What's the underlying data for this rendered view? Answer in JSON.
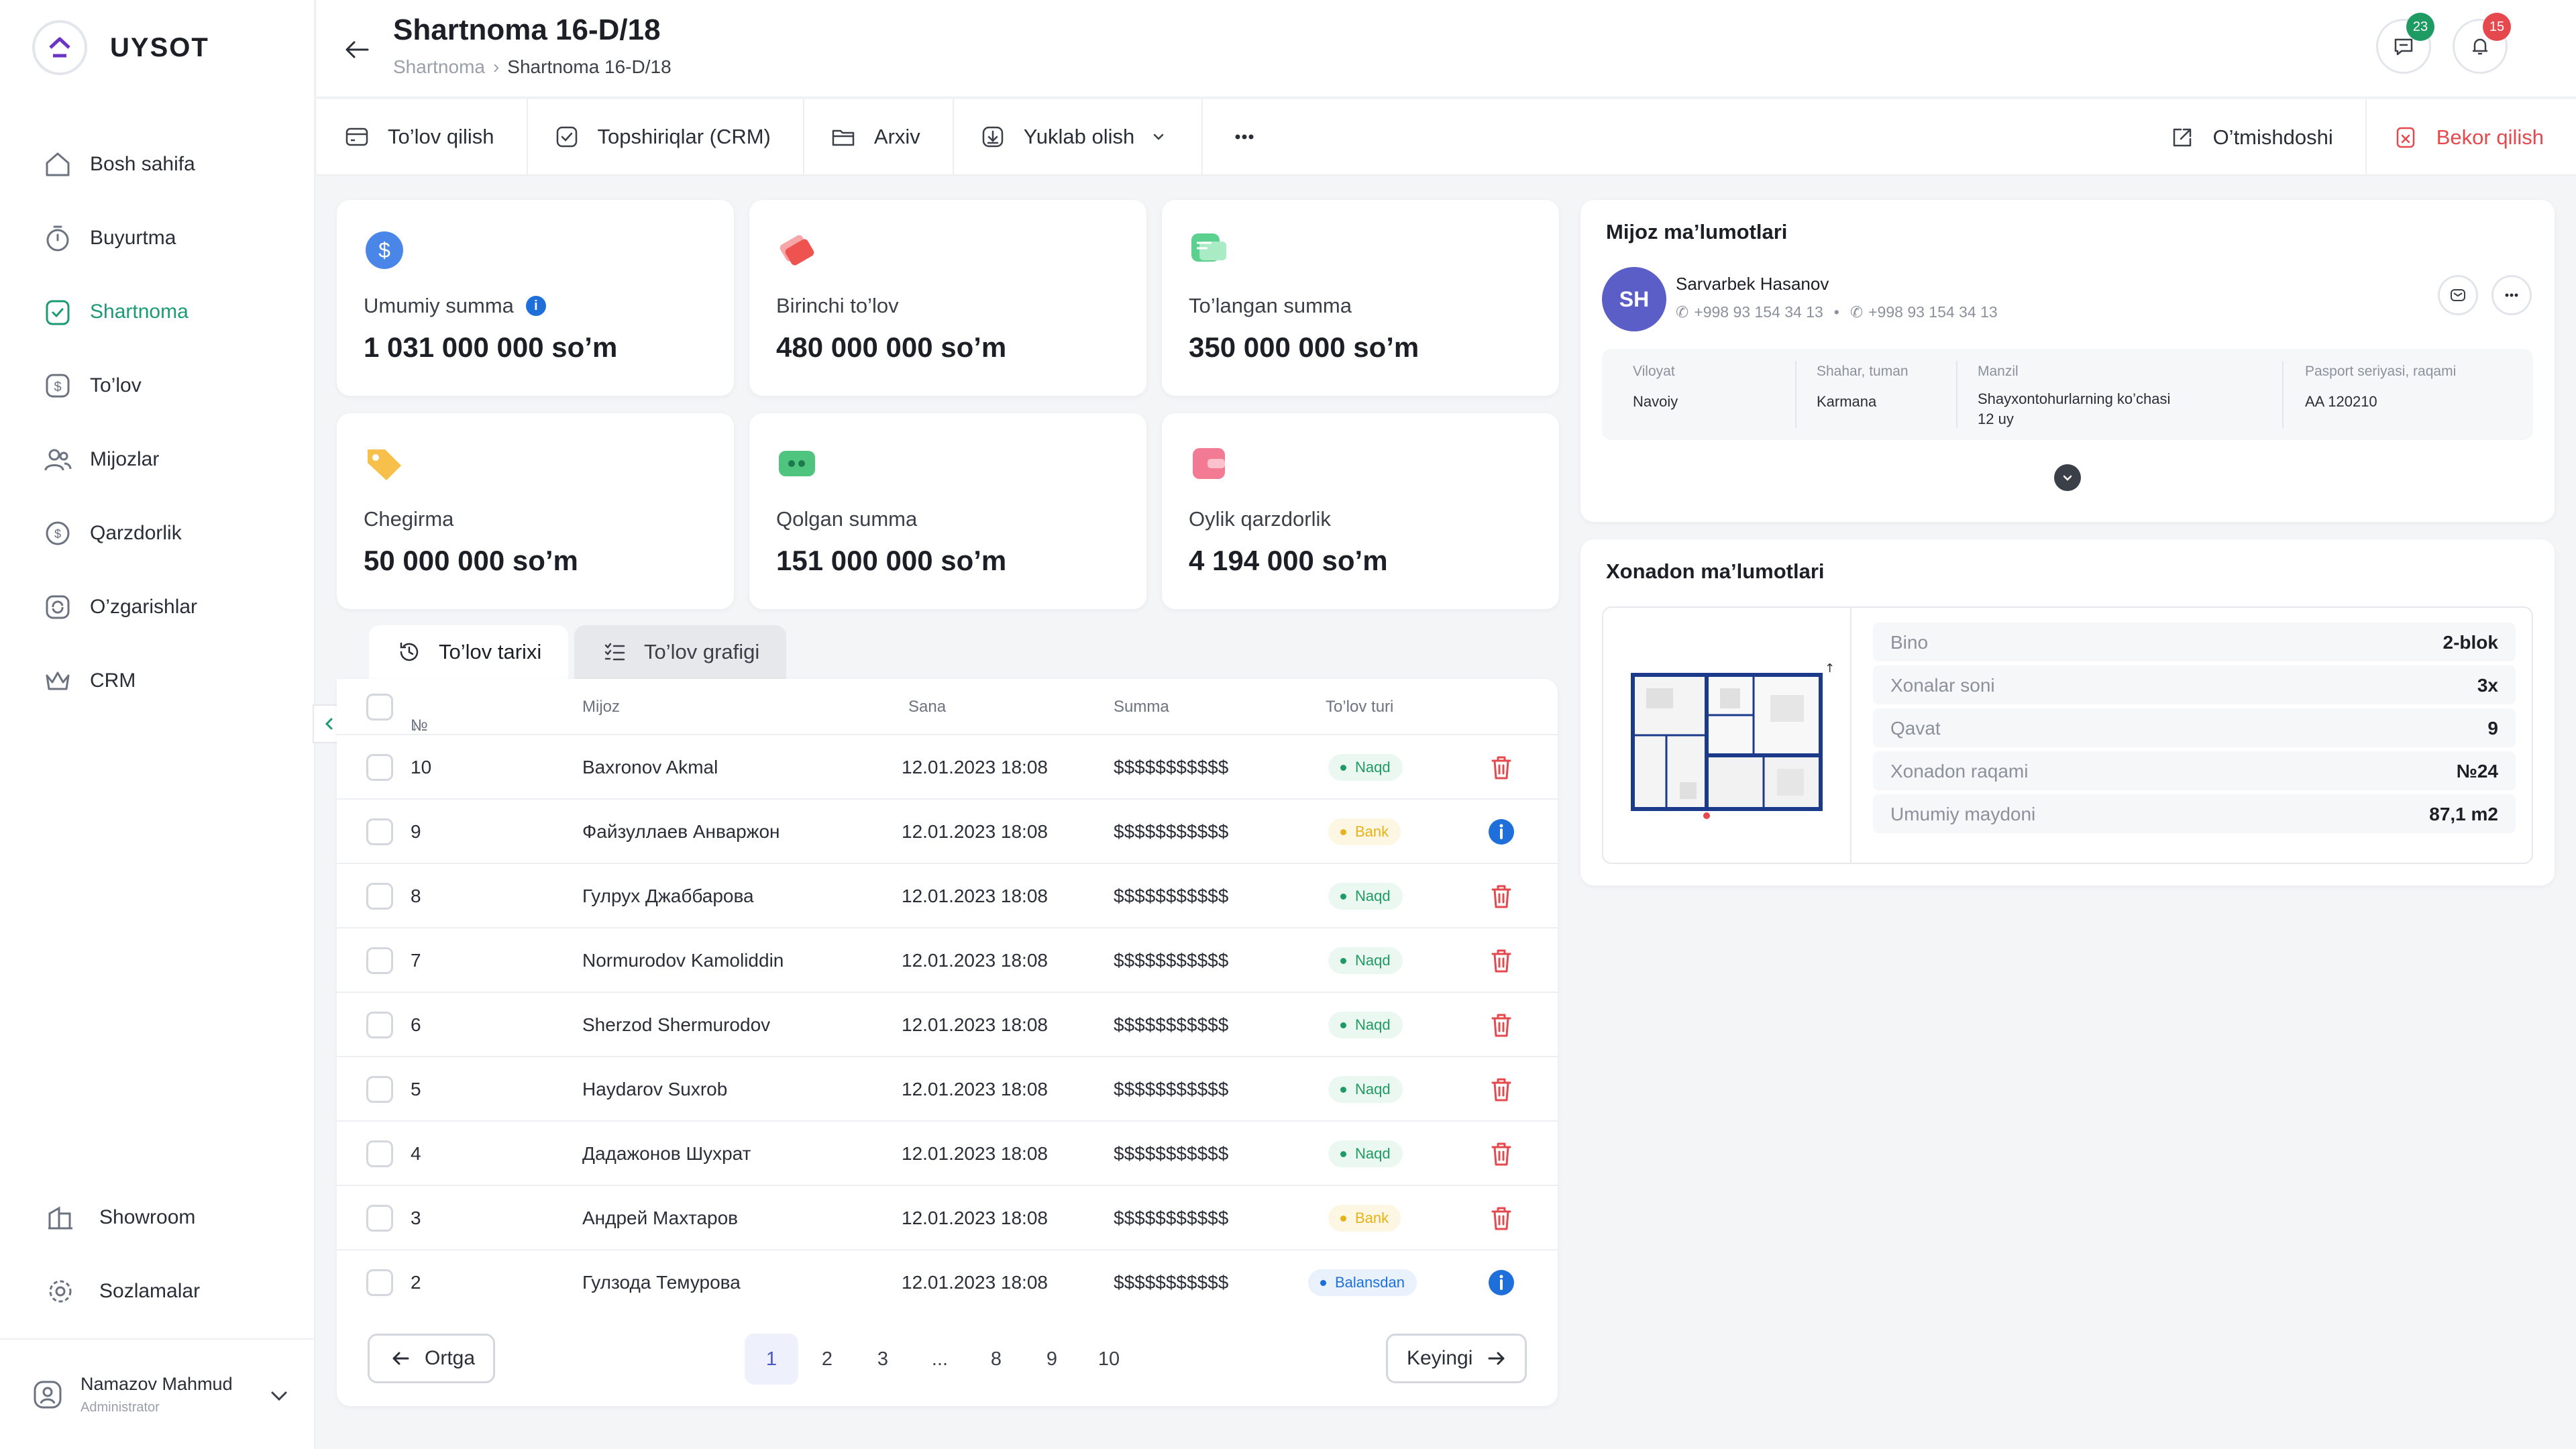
{
  "brand": {
    "name": "UYSOT"
  },
  "sidebar": {
    "items": [
      {
        "label": "Bosh sahifa",
        "icon": "home-icon"
      },
      {
        "label": "Buyurtma",
        "icon": "timer-icon"
      },
      {
        "label": "Shartnoma",
        "icon": "shield-check-icon",
        "active": true
      },
      {
        "label": "To’lov",
        "icon": "dollar-icon"
      },
      {
        "label": "Mijozlar",
        "icon": "users-icon"
      },
      {
        "label": "Qarzdorlik",
        "icon": "debt-icon"
      },
      {
        "label": "O’zgarishlar",
        "icon": "refresh-icon"
      },
      {
        "label": "CRM",
        "icon": "crown-icon"
      }
    ],
    "bottom": [
      {
        "label": "Showroom",
        "icon": "building-icon"
      },
      {
        "label": "Sozlamalar",
        "icon": "gear-icon"
      }
    ],
    "user": {
      "name": "Namazov Mahmud",
      "role": "Administrator"
    }
  },
  "header": {
    "title": "Shartnoma 16-D/18",
    "breadcrumb": [
      "Shartnoma",
      "Shartnoma 16-D/18"
    ],
    "messages_count": "23",
    "notifications_count": "15"
  },
  "toolbar": {
    "pay": "To’lov qilish",
    "tasks": "Topshiriqlar (CRM)",
    "archive": "Arxiv",
    "download": "Yuklab olish",
    "predecessor": "O’tmishdoshi",
    "cancel": "Bekor qilish"
  },
  "stats": [
    {
      "label": "Umumiy summa",
      "value": "1 031 000 000 so’m"
    },
    {
      "label": "Birinchi to’lov",
      "value": "480 000 000 so’m"
    },
    {
      "label": "To’langan summa",
      "value": "350 000 000 so’m"
    },
    {
      "label": "Chegirma",
      "value": "50 000 000 so’m"
    },
    {
      "label": "Qolgan summa",
      "value": "151 000 000 so’m"
    },
    {
      "label": "Oylik qarzdorlik",
      "value": "4 194 000 so’m"
    }
  ],
  "tabs": {
    "history": "To’lov tarixi",
    "schedule": "To’lov grafigi"
  },
  "table": {
    "headers": {
      "no": "№",
      "client": "Mijoz",
      "date": "Sana",
      "amount": "Summa",
      "type": "To’lov turi"
    },
    "rows": [
      {
        "no": "10",
        "client": "Baxronov Akmal",
        "date": "12.01.2023 18:08",
        "amount": "$$$$$$$$$$$",
        "type": "Naqd"
      },
      {
        "no": "9",
        "client": "Файзуллаев Анваржон",
        "date": "12.01.2023 18:08",
        "amount": "$$$$$$$$$$$",
        "type": "Bank"
      },
      {
        "no": "8",
        "client": "Гулрух Джаббарова",
        "date": "12.01.2023 18:08",
        "amount": "$$$$$$$$$$$",
        "type": "Naqd"
      },
      {
        "no": "7",
        "client": "Normurodov Kamoliddin",
        "date": "12.01.2023 18:08",
        "amount": "$$$$$$$$$$$",
        "type": "Naqd"
      },
      {
        "no": "6",
        "client": "Sherzod Shermurodov",
        "date": "12.01.2023 18:08",
        "amount": "$$$$$$$$$$$",
        "type": "Naqd"
      },
      {
        "no": "5",
        "client": "Haydarov Suxrob",
        "date": "12.01.2023 18:08",
        "amount": "$$$$$$$$$$$",
        "type": "Naqd"
      },
      {
        "no": "4",
        "client": "Дадажонов Шухрат",
        "date": "12.01.2023 18:08",
        "amount": "$$$$$$$$$$$",
        "type": "Naqd"
      },
      {
        "no": "3",
        "client": "Андрей Махтаров",
        "date": "12.01.2023 18:08",
        "amount": "$$$$$$$$$$$",
        "type": "Bank"
      },
      {
        "no": "2",
        "client": "Гулзода Темурова",
        "date": "12.01.2023 18:08",
        "amount": "$$$$$$$$$$$",
        "type": "Balansdan"
      }
    ]
  },
  "pagination": {
    "prev": "Ortga",
    "next": "Keyingi",
    "pages": [
      "1",
      "2",
      "3",
      "...",
      "8",
      "9",
      "10"
    ],
    "current": "1"
  },
  "customer": {
    "title": "Mijoz ma’lumotlari",
    "initials": "SH",
    "name": "Sarvarbek Hasanov",
    "phone1": "+998 93 154 34 13",
    "phone2": "+998 93 154 34 13",
    "region_label": "Viloyat",
    "region": "Navoiy",
    "city_label": "Shahar, tuman",
    "city": "Karmana",
    "address_label": "Manzil",
    "address_line1": "Shayxontohurlarning ko’chasi",
    "address_line2": "12 uy",
    "passport_label": "Pasport seriyasi, raqami",
    "passport": "AA 120210"
  },
  "apartment": {
    "title": "Xonadon ma’lumotlari",
    "rows": [
      {
        "label": "Bino",
        "value": "2-blok"
      },
      {
        "label": "Xonalar soni",
        "value": "3x"
      },
      {
        "label": "Qavat",
        "value": "9"
      },
      {
        "label": "Xonadon raqami",
        "value": "№24"
      },
      {
        "label": "Umumiy maydoni",
        "value": "87,1 m2"
      }
    ]
  },
  "colors": {
    "accent": "#1c9a73",
    "danger": "#e5484d",
    "info": "#1e6fd9",
    "avatar": "#5a5ec6"
  }
}
